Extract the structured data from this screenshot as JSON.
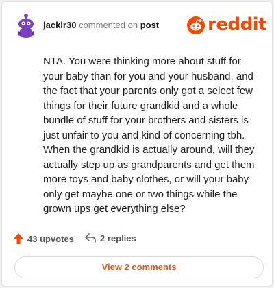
{
  "header": {
    "username": "jackir30",
    "action_text": "commented on",
    "post_link": "post",
    "logo_text": "reddit"
  },
  "comment": {
    "body": "NTA. You were thinking more about stuff for your baby than for you and your husband, and the fact that your parents only got a select few things for their future grandkid and a whole bundle of stuff for your brothers and sisters is just unfair to you and kind of concerning tbh. When the grandkid is actually around, will they actually step up as grandparents and get them more toys and baby clothes, or will your baby only get maybe one or two things while the grown ups get everything else?"
  },
  "footer": {
    "upvotes": "43 upvotes",
    "replies": "2 replies"
  },
  "view_comments_label": "View 2 comments",
  "icons": {
    "avatar": "snoo-avatar-icon",
    "logo": "reddit-logo-icon",
    "upvote": "upvote-arrow-icon",
    "reply": "reply-arrow-icon"
  },
  "colors": {
    "brand": "#ff4500",
    "avatar": "#7b3fc4",
    "button_text": "#e8530e"
  }
}
